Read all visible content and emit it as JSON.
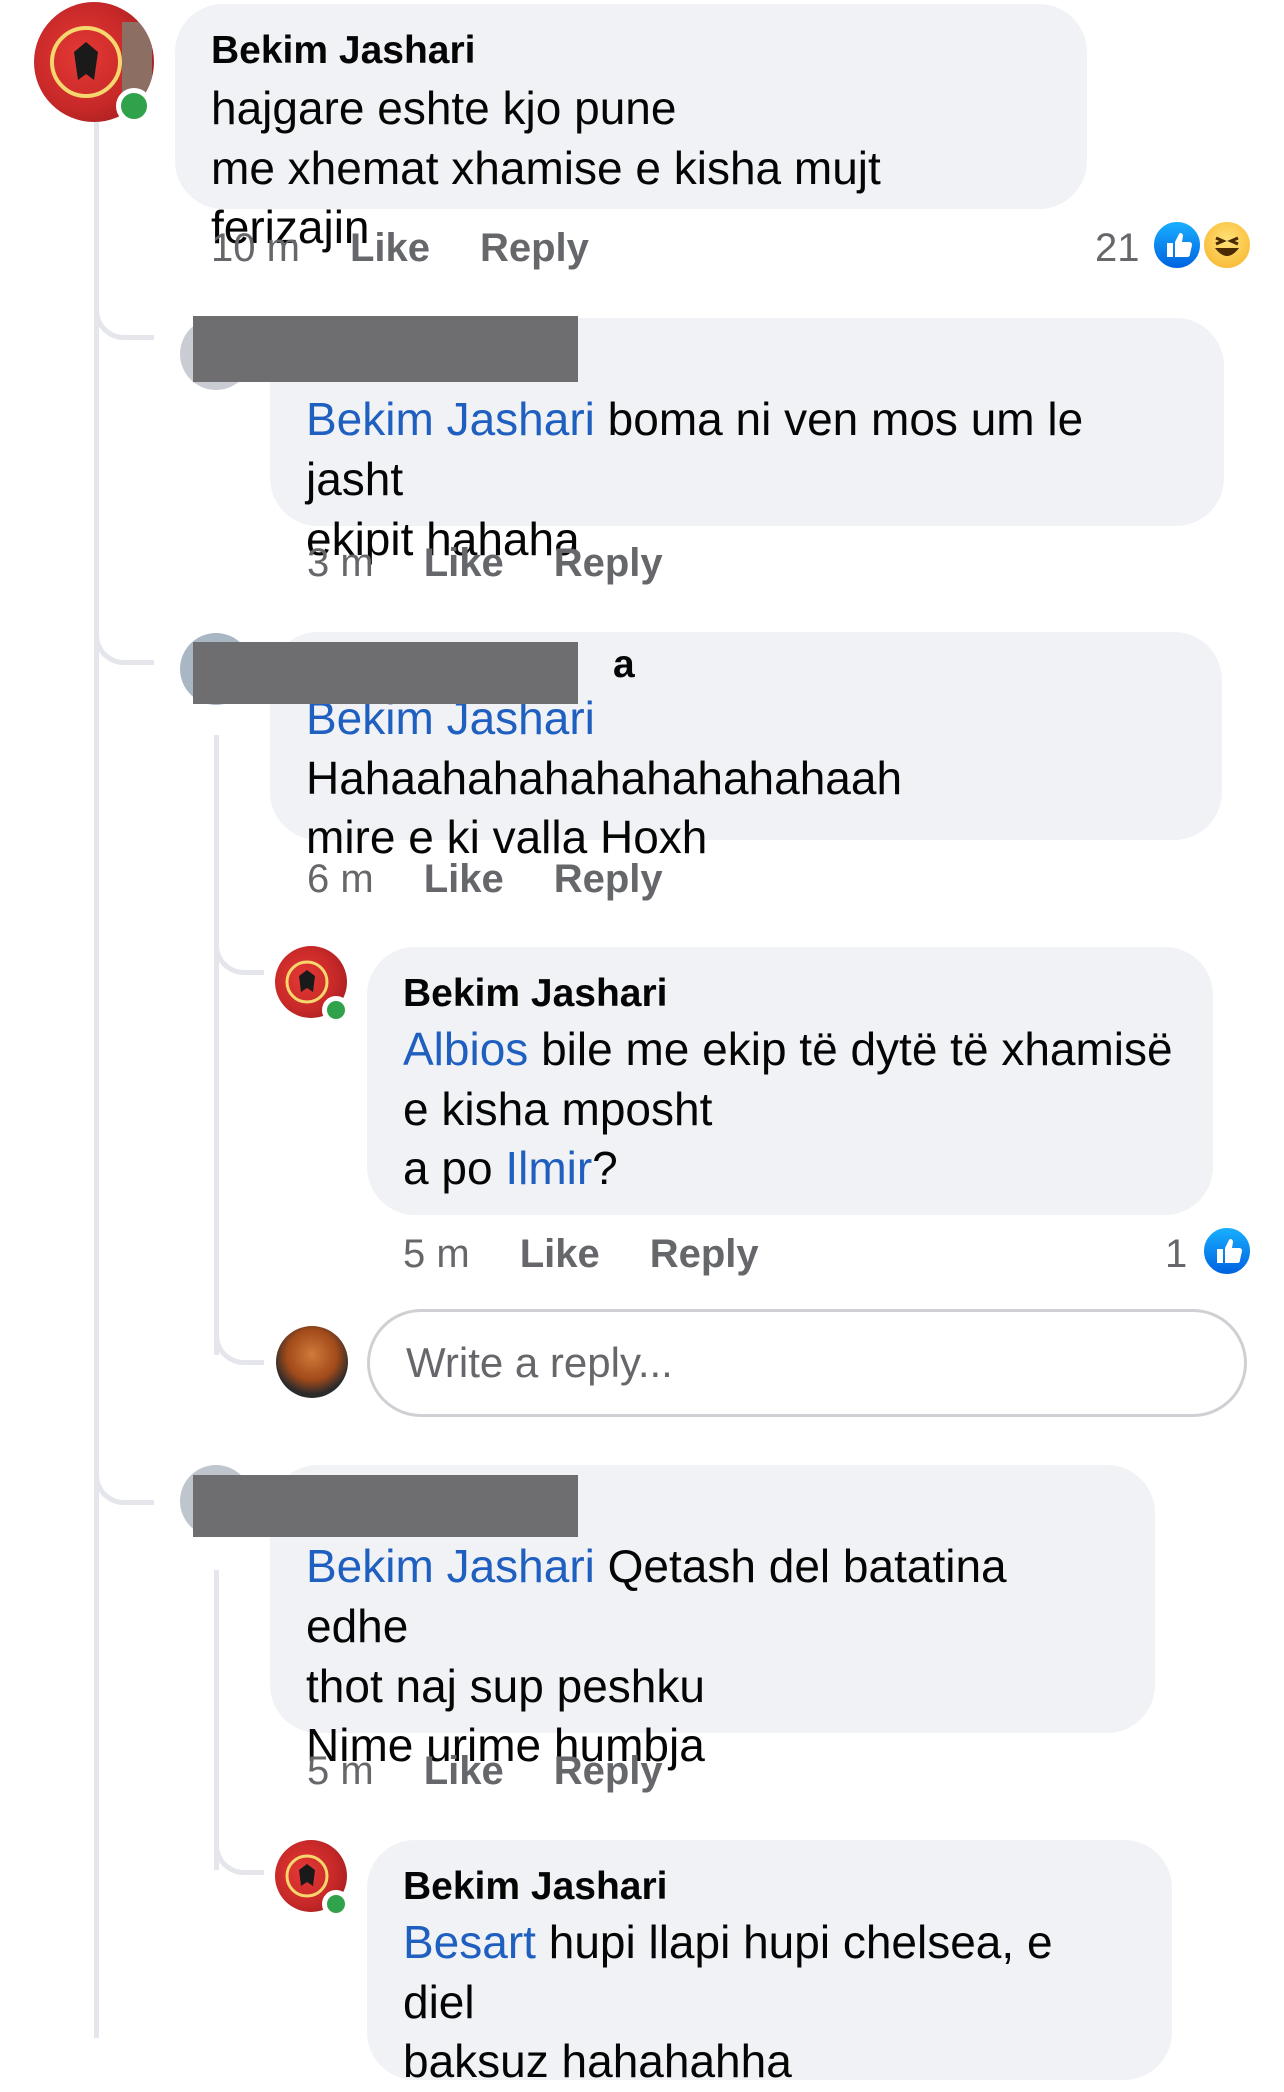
{
  "comments": [
    {
      "author": "Bekim Jashari",
      "lines": [
        "hajgare eshte kjo pune",
        "me xhemat xhamise e kisha mujt ferizajin"
      ],
      "time": "10 m",
      "like": "Like",
      "reply": "Reply",
      "reaction_count": "21",
      "reactions": [
        "like-icon",
        "haha-icon"
      ],
      "online": true
    },
    {
      "author": "",
      "mention": "Bekim Jashari",
      "line1": "boma ni ven mos um le jasht",
      "line2": "ekipit hahaha",
      "time": "3 m",
      "like": "Like",
      "reply": "Reply"
    },
    {
      "author_visible_fragment": "a",
      "mention": "Bekim Jashari",
      "line1": "Hahaahahahahahahahahaah",
      "line2": "mire e ki valla Hoxh",
      "time": "6 m",
      "like": "Like",
      "reply": "Reply"
    },
    {
      "author": "Bekim Jashari",
      "mention": "Albios",
      "line1": "bile me ekip të dytë të xhamisë",
      "line2": "e kisha mposht",
      "line3_prefix": "a po",
      "line3_mention": "Ilmir",
      "line3_suffix": "?",
      "time": "5 m",
      "like": "Like",
      "reply": "Reply",
      "reaction_count": "1",
      "online": true
    },
    {
      "author": "",
      "mention": "Bekim Jashari",
      "line1": "Qetash del batatina edhe",
      "line2": "thot naj sup peshku",
      "line3": "Nime urime humbja",
      "time": "5 m",
      "like": "Like",
      "reply": "Reply"
    },
    {
      "author": "Bekim Jashari",
      "mention": "Besart",
      "line1": "hupi llapi hupi chelsea, e diel",
      "line2": "baksuz hahahahha",
      "online": true
    }
  ],
  "reply_box": {
    "placeholder": "Write a reply..."
  },
  "colors": {
    "mention": "#1f5fbf",
    "bubble": "#f0f2f5",
    "meta": "#65676b",
    "online": "#31a24c"
  }
}
